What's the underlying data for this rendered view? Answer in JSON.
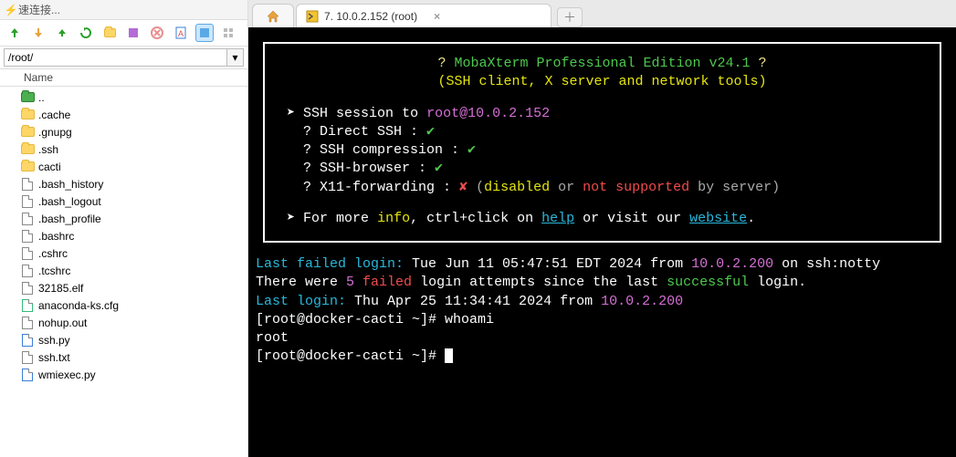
{
  "sidebar": {
    "quick_connect_label": "速连接...",
    "path": "/root/",
    "name_header": "Name",
    "items": [
      {
        "name": "..",
        "type": "folder-green"
      },
      {
        "name": ".cache",
        "type": "folder"
      },
      {
        "name": ".gnupg",
        "type": "folder"
      },
      {
        "name": ".ssh",
        "type": "folder"
      },
      {
        "name": "cacti",
        "type": "folder"
      },
      {
        "name": ".bash_history",
        "type": "file"
      },
      {
        "name": ".bash_logout",
        "type": "file"
      },
      {
        "name": ".bash_profile",
        "type": "file"
      },
      {
        "name": ".bashrc",
        "type": "file"
      },
      {
        "name": ".cshrc",
        "type": "file"
      },
      {
        "name": ".tcshrc",
        "type": "file"
      },
      {
        "name": "32185.elf",
        "type": "file"
      },
      {
        "name": "anaconda-ks.cfg",
        "type": "cfg"
      },
      {
        "name": "nohup.out",
        "type": "file"
      },
      {
        "name": "ssh.py",
        "type": "py"
      },
      {
        "name": "ssh.txt",
        "type": "txt"
      },
      {
        "name": "wmiexec.py",
        "type": "py"
      }
    ]
  },
  "tabs": {
    "session_label": "7. 10.0.2.152 (root)"
  },
  "banner": {
    "title_left": "? ",
    "title_main": "MobaXterm Professional Edition v24.1",
    "title_right": " ?",
    "subtitle": "(SSH client, X server and network tools)",
    "session_prefix": "SSH session to ",
    "session_target": "root@10.0.2.152",
    "rows": [
      {
        "label": "? Direct SSH      :",
        "status": "check"
      },
      {
        "label": "? SSH compression :",
        "status": "check"
      },
      {
        "label": "? SSH-browser     :",
        "status": "check"
      },
      {
        "label": "? X11-forwarding  :",
        "status": "x",
        "note_pre": "(",
        "note_disabled": "disabled",
        "note_or": " or ",
        "note_ns": "not supported",
        "note_by": " by server)"
      }
    ],
    "footer_pre": "For more ",
    "footer_info": "info",
    "footer_mid": ", ctrl+click on ",
    "footer_help": "help",
    "footer_or": " or visit our ",
    "footer_site": "website",
    "footer_dot": "."
  },
  "term": {
    "failed_label": "Last failed login:",
    "failed_time": " Tue Jun 11 05:47:51 EDT 2024 from ",
    "failed_ip": "10.0.2.200",
    "failed_tail": " on ssh:notty",
    "were_pre": "There were ",
    "were_n": "5",
    "were_failed": " failed",
    "were_mid": " login attempts since the last ",
    "were_succ": "successful",
    "were_tail": " login.",
    "last_label": "Last login:",
    "last_time": " Thu Apr 25 11:34:41 2024 from ",
    "last_ip": "10.0.2.200",
    "prompt1_pre": "[root@docker-cacti ~]# ",
    "prompt1_cmd": "whoami",
    "whoami_out": "root",
    "prompt2_pre": "[root@docker-cacti ~]# "
  }
}
